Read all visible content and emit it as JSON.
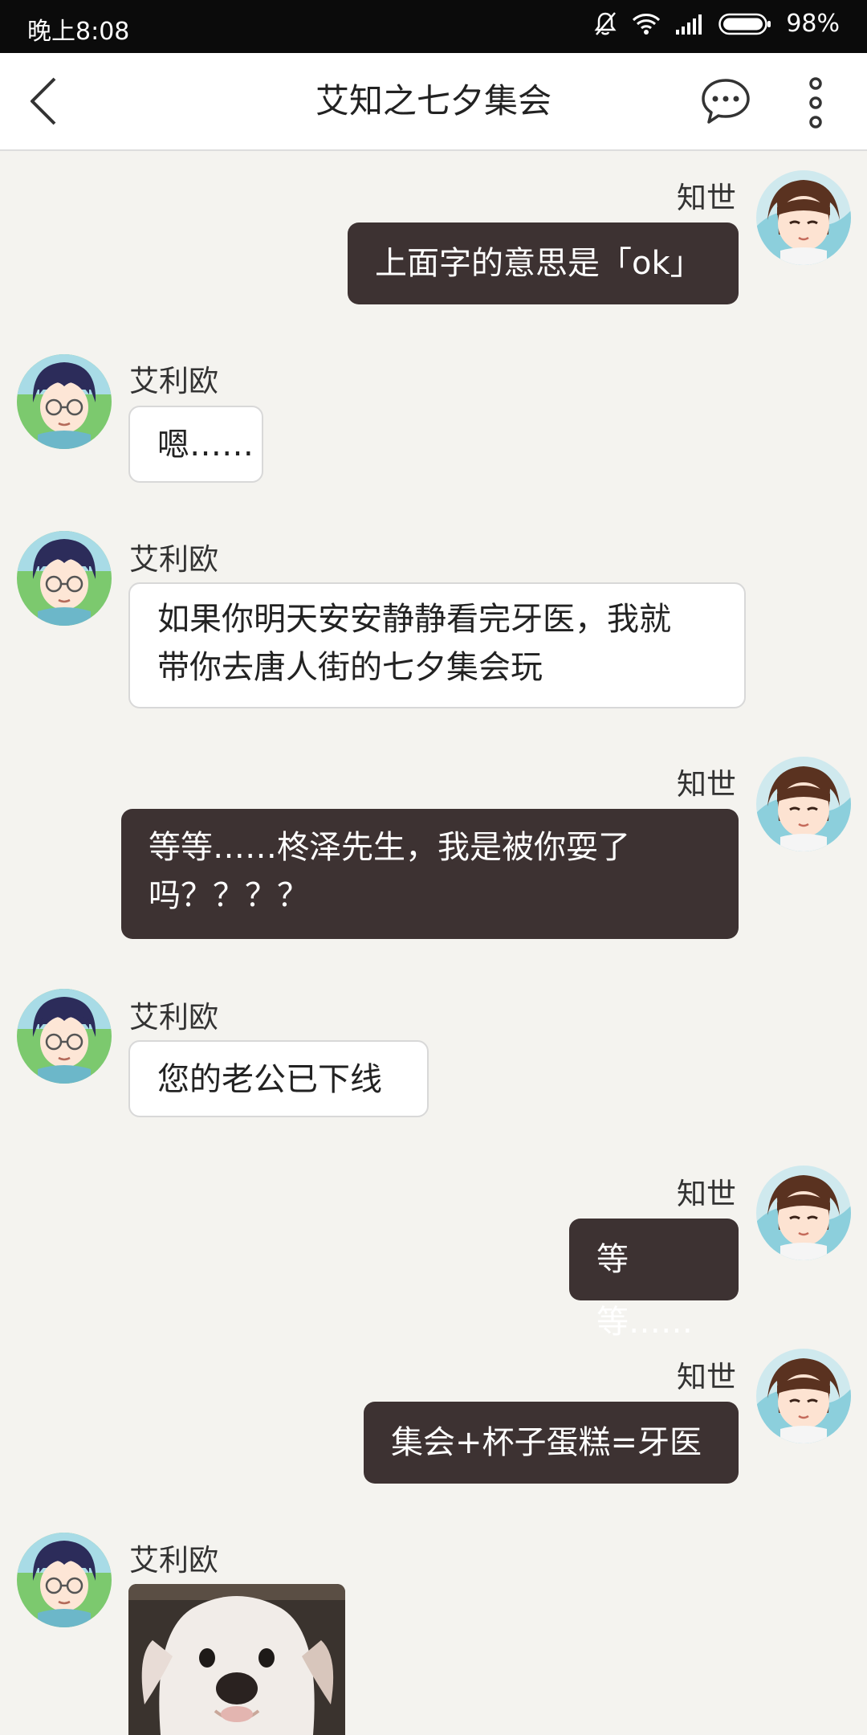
{
  "status_bar": {
    "time": "晚上8:08",
    "battery": "98%"
  },
  "header": {
    "title": "艾知之七夕集会"
  },
  "messages": [
    {
      "sender": "知世",
      "side": "right",
      "text": "上面字的意思是「ok」"
    },
    {
      "sender": "艾利欧",
      "side": "left",
      "text": "嗯……"
    },
    {
      "sender": "艾利欧",
      "side": "left",
      "lines": [
        "如果你明天安安静静看完牙医，我就",
        "带你去唐人街的七夕集会玩"
      ]
    },
    {
      "sender": "知世",
      "side": "right",
      "lines": [
        "等等……柊泽先生，我是被你耍了",
        "吗？？？？"
      ]
    },
    {
      "sender": "艾利欧",
      "side": "left",
      "text": "您的老公已下线"
    },
    {
      "sender": "知世",
      "side": "right",
      "text": "等等……"
    },
    {
      "sender": "知世",
      "side": "right",
      "text": "集会+杯子蛋糕=牙医"
    },
    {
      "sender": "艾利欧",
      "side": "left",
      "image": "dog-photo"
    }
  ],
  "colors": {
    "outgoing_bubble": "#3d3232",
    "incoming_bubble": "#ffffff",
    "background": "#f4f3ef"
  },
  "icons": [
    "silent-bell-icon",
    "wifi-icon",
    "signal-icon",
    "battery-icon",
    "back-arrow-icon",
    "chat-bubble-icon",
    "more-vertical-icon"
  ]
}
